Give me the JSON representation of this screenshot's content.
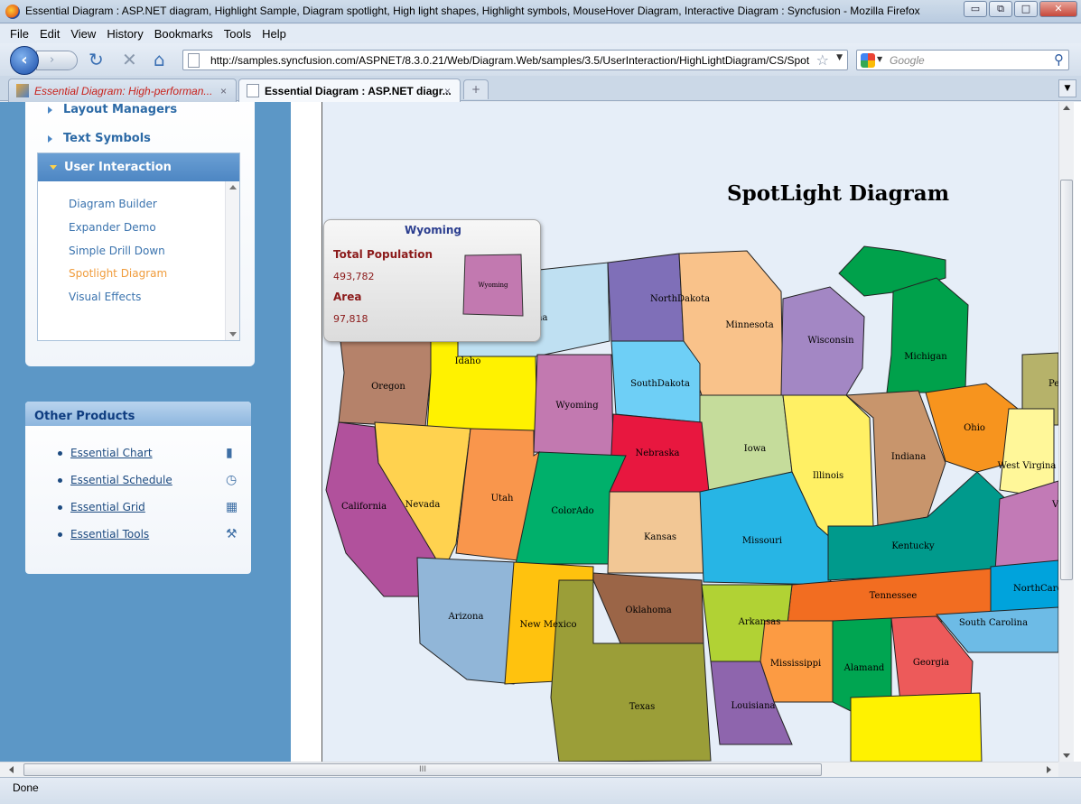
{
  "window": {
    "title": "Essential Diagram : ASP.NET diagram, Highlight Sample, Diagram spotlight, High light shapes, Highlight symbols, MouseHover Diagram, Interactive Diagram : Syncfusion - Mozilla Firefox",
    "min": "▭",
    "restore": "⧉",
    "max": "□",
    "close": "✕"
  },
  "menu": [
    "File",
    "Edit",
    "View",
    "History",
    "Bookmarks",
    "Tools",
    "Help"
  ],
  "nav": {
    "back": "‹",
    "forward": "›",
    "reload": "↻",
    "stop": "✕",
    "home": "⌂",
    "url": "http://samples.syncfusion.com/ASPNET/8.3.0.21/Web/Diagram.Web/samples/3.5/UserInteraction/HighLightDiagram/CS/Spot",
    "search_placeholder": "Google"
  },
  "tabs": [
    {
      "label": "Essential Diagram: High-performan...",
      "close": "×"
    },
    {
      "label": "Essential Diagram : ASP.NET diagr...",
      "close": "×"
    }
  ],
  "newtab": "+",
  "sidebar": {
    "items": [
      "Layout Managers",
      "Text Symbols"
    ],
    "section": "User Interaction",
    "links": [
      "Diagram Builder",
      "Expander Demo",
      "Simple Drill Down",
      "Spotlight Diagram",
      "Visual Effects"
    ],
    "active_link": "Spotlight Diagram"
  },
  "other_products": {
    "title": "Other Products",
    "items": [
      {
        "label": "Essential Chart",
        "icon": "bar-chart-icon"
      },
      {
        "label": "Essential Schedule",
        "icon": "clock-icon"
      },
      {
        "label": "Essential Grid",
        "icon": "grid-icon"
      },
      {
        "label": "Essential Tools",
        "icon": "wrench-icon"
      }
    ]
  },
  "map": {
    "title": "SpotLight Diagram",
    "states": [
      "NorthDakota",
      "Minnesota",
      "Wisconsin",
      "Michigan",
      "Idaho",
      "Oregon",
      "Wyoming",
      "SouthDakota",
      "Pe",
      "Ohio",
      "Iowa",
      "Illinois",
      "Indiana",
      "Nebraska",
      "West Virgina",
      "California",
      "Nevada",
      "Utah",
      "ColorAdo",
      "Kansas",
      "Missouri",
      "Kentucky",
      "V",
      "Tennessee",
      "NorthCaro",
      "Arizona",
      "New Mexico",
      "Oklahoma",
      "Arkansas",
      "South Carolina",
      "Mississippi",
      "Alamand",
      "Georgia",
      "Texas",
      "Louisiana",
      "na"
    ]
  },
  "tooltip": {
    "state": "Wyoming",
    "population_label": "Total Population",
    "population": "493,782",
    "area_label": "Area",
    "area": "97,818",
    "shape_label": "Wyoming"
  },
  "status": "Done",
  "scroll_grip": "III"
}
